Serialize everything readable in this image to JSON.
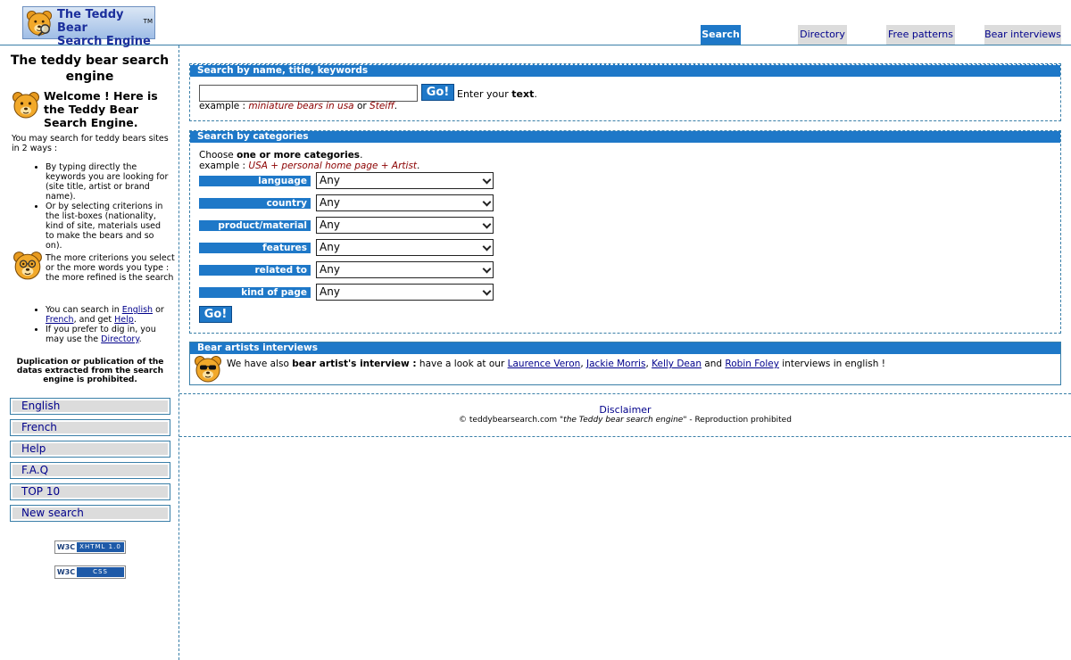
{
  "header": {
    "logo_line1": "The Teddy Bear",
    "logo_line2": "Search Engine",
    "logo_tm": "TM",
    "tabs": [
      {
        "label": "Search",
        "active": true
      },
      {
        "label": "Directory",
        "active": false
      },
      {
        "label": "Free patterns",
        "active": false
      },
      {
        "label": "Bear interviews",
        "active": false
      }
    ]
  },
  "sidebar": {
    "title": "The teddy bear search engine",
    "welcome": "Welcome ! Here is the Teddy Bear Search Engine.",
    "intro": "You may search for teddy bears sites in 2 ways :",
    "ways": [
      "By typing directly the keywords you are looking for (site title, artist or brand name).",
      "Or by selecting criterions in the list-boxes (nationality, kind of site, materials used to make the bears and so on)."
    ],
    "more_criterions": "The more criterions you select or the more words you type : the more refined is the search",
    "lang_item": {
      "prefix": "You can search in ",
      "english": "English",
      "or": " or ",
      "french": "French",
      "and_get": ", and get ",
      "help": "Help",
      "end": "."
    },
    "dig_item": {
      "prefix": "If you prefer to dig in, you may use the ",
      "directory": "Directory",
      "end": "."
    },
    "duplication": "Duplication or publication of the datas extracted from the search engine is prohibited.",
    "nav": [
      "English",
      "French",
      "Help",
      "F.A.Q",
      "TOP 10",
      "New search"
    ],
    "badges": [
      {
        "w3c": "W3C",
        "text": "XHTML 1.0"
      },
      {
        "w3c": "W3C",
        "text": "CSS"
      }
    ]
  },
  "search_keywords": {
    "heading": "Search by name, title, keywords",
    "input_value": "",
    "go_label": "Go!",
    "enter_prefix": "Enter your ",
    "enter_bold": "text",
    "enter_end": ".",
    "example_prefix": "example : ",
    "example_1": "miniature bears in usa",
    "example_or": " or ",
    "example_2": "Steiff",
    "example_end": "."
  },
  "search_categories": {
    "heading": "Search by categories",
    "choose_prefix": "Choose ",
    "choose_bold": "one or more categories",
    "choose_end": ".",
    "example_prefix": "example : ",
    "example_value": "USA + personal home page + Artist",
    "example_end": ".",
    "categories": [
      {
        "label": "language",
        "value": "Any"
      },
      {
        "label": "country",
        "value": "Any"
      },
      {
        "label": "product/material",
        "value": "Any"
      },
      {
        "label": "features",
        "value": "Any"
      },
      {
        "label": "related to",
        "value": "Any"
      },
      {
        "label": "kind of page",
        "value": "Any"
      }
    ],
    "go_label": "Go!"
  },
  "interviews": {
    "heading": "Bear artists interviews",
    "prefix": "We have also ",
    "bold": "bear artist's interview :",
    "middle": " have a look at our ",
    "artists": [
      "Laurence Veron",
      "Jackie Morris",
      "Kelly Dean",
      "Robin Foley"
    ],
    "sep": ", ",
    "and": " and ",
    "end": " interviews in english !"
  },
  "footer": {
    "disclaimer": "Disclaimer",
    "copyright_prefix": "© teddybearsearch.com ",
    "copyright_italic": "\"the Teddy bear search engine\"",
    "copyright_end": " - Reproduction prohibited"
  },
  "colors": {
    "accent": "#1e78c8",
    "border": "#3a7fa8",
    "link": "#00008b",
    "example_text": "#8b0000",
    "tab_bg": "#dcdcdc"
  },
  "icons": [
    "teddy-bear-magnifier-icon",
    "teddy-bear-icon",
    "teddy-bear-glasses-icon",
    "teddy-bear-sunglasses-icon"
  ]
}
